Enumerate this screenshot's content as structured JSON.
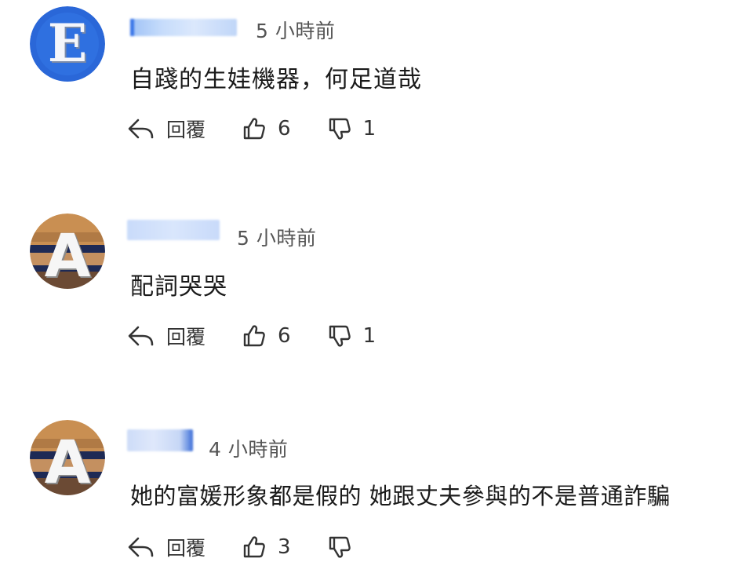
{
  "comments": [
    {
      "avatar_letter": "E",
      "timestamp": "5 小時前",
      "text": "自踐的生娃機器，何足道哉",
      "reply_label": "回覆",
      "likes": "6",
      "dislikes": "1"
    },
    {
      "avatar_letter": "A",
      "timestamp": "5 小時前",
      "text": "配詞哭哭",
      "reply_label": "回覆",
      "likes": "6",
      "dislikes": "1"
    },
    {
      "avatar_letter": "A",
      "timestamp": "4 小時前",
      "text": "她的富媛形象都是假的 她跟丈夫參與的不是普通詐騙",
      "reply_label": "回覆",
      "likes": "3",
      "dislikes": ""
    }
  ],
  "colors": {
    "avatar_e_bg": "#2a67d8",
    "avatar_a_top": "#c98f52",
    "avatar_a_band": "#1e2a55",
    "avatar_a_bottom": "#6b4a34",
    "text": "#1a1a1a",
    "muted": "#555555"
  },
  "icons": {
    "reply": "reply-arrow-icon",
    "like": "thumbs-up-icon",
    "dislike": "thumbs-down-icon"
  }
}
